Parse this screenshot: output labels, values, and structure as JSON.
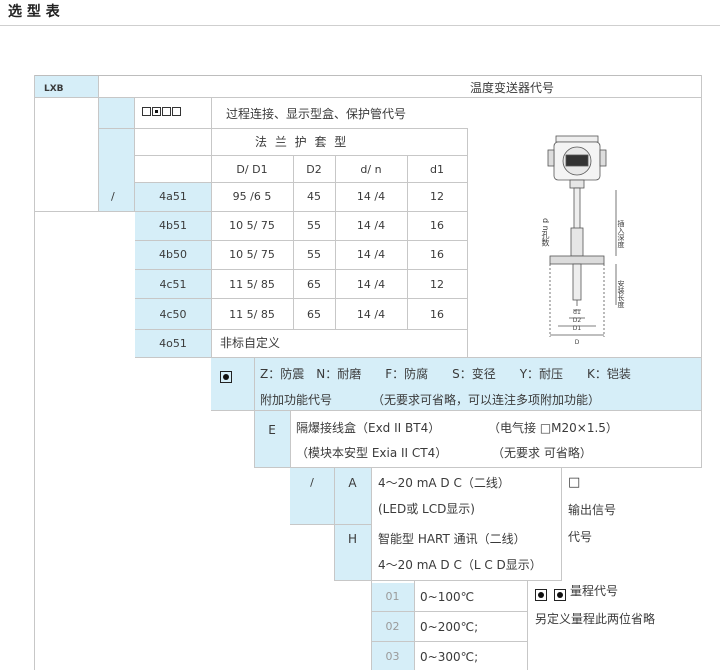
{
  "heading": "选 型 表",
  "header_row": {
    "model": "LXB",
    "title": "温度变送器代号"
  },
  "connection": {
    "code_boxes": "□◘□□",
    "label": "过程连接、显示型盒、保护管代号",
    "flange_title": "法 兰 护 套 型",
    "columns": [
      "D/ D1",
      "D2",
      "d/ n",
      "d1"
    ],
    "slash": "/",
    "rows": [
      {
        "code": "4a51",
        "d_d1": "95 /6 5",
        "d2": "45",
        "dn": "14 /4",
        "d1": "12"
      },
      {
        "code": "4b51",
        "d_d1": "10 5/ 75",
        "d2": "55",
        "dn": "14 /4",
        "d1": "16"
      },
      {
        "code": "4b50",
        "d_d1": "10 5/ 75",
        "d2": "55",
        "dn": "14 /4",
        "d1": "16"
      },
      {
        "code": "4c51",
        "d_d1": "11 5/ 85",
        "d2": "65",
        "dn": "14 /4",
        "d1": "12"
      },
      {
        "code": "4c50",
        "d_d1": "11 5/ 85",
        "d2": "65",
        "dn": "14 /4",
        "d1": "16"
      },
      {
        "code": "4o51",
        "custom": "非标自定义"
      }
    ]
  },
  "drawing": {
    "label_holes": "d n孔数",
    "label_insert": "插入深度",
    "label_length": "安装长度",
    "dims": [
      "d1",
      "D2",
      "D1",
      "D"
    ]
  },
  "additional": {
    "options": "Z：防震　N：耐磨　　F：防腐　　S：变径　　Y：耐压　　K：铠装",
    "label": "附加功能代号",
    "note": "（无要求可省略，可以连注多项附加功能）"
  },
  "housing": {
    "code": "E",
    "line1": "隔爆接线盒（Exd II BT4）",
    "line1_right": "（电气接 □M20×1.5）",
    "line2": "（模块本安型 Exia II CT4）",
    "line2_right": "（无要求 可省略）"
  },
  "output": {
    "slash": "/",
    "rows": [
      {
        "code": "A",
        "line1": "4～20 mA D C（二线）",
        "line2": "(LED或 LCD显示)"
      },
      {
        "code": "H",
        "line1": "智能型 HART 通讯（二线）",
        "line2": "4～20 mA D C（L C D显示）"
      }
    ],
    "side_box": "□",
    "side_label1": "输出信号",
    "side_label2": "代号"
  },
  "range": {
    "rows": [
      {
        "code": "01",
        "value": "0~100℃"
      },
      {
        "code": "02",
        "value": "0~200℃;"
      },
      {
        "code": "03",
        "value": "0~300℃;"
      }
    ],
    "label": "量程代号",
    "note": "另定义量程此两位省略"
  }
}
